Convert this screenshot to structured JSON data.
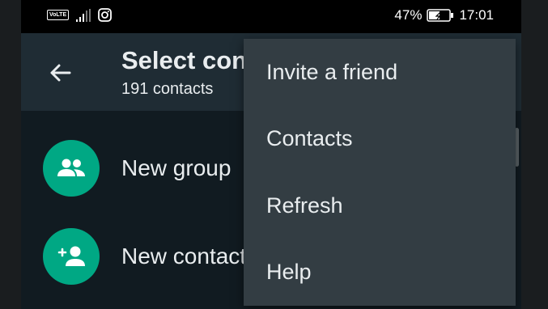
{
  "statusbar": {
    "volte": "VoLTE",
    "battery_percent": "47%",
    "time": "17:01"
  },
  "appbar": {
    "title": "Select contact",
    "subtitle": "191 contacts"
  },
  "list": [
    {
      "label": "New group",
      "icon": "group-icon"
    },
    {
      "label": "New contact",
      "icon": "add-person-icon"
    }
  ],
  "menu": {
    "items": [
      "Invite a friend",
      "Contacts",
      "Refresh",
      "Help"
    ]
  },
  "colors": {
    "accent": "#00a884",
    "background": "#111b21",
    "appbar": "#1f2c34",
    "menu": "#333d43"
  }
}
